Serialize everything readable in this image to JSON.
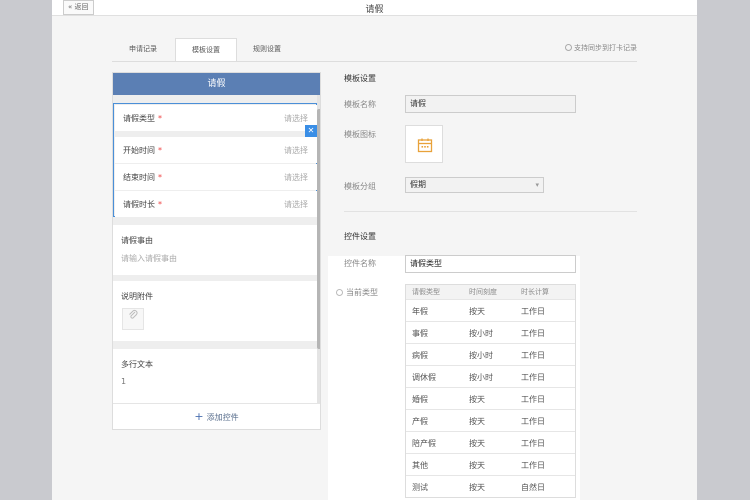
{
  "window": {
    "title": "请假",
    "back_label": "« 返回"
  },
  "tabs": [
    {
      "label": "申请记录",
      "active": false
    },
    {
      "label": "模板设置",
      "active": true
    },
    {
      "label": "规则设置",
      "active": false
    }
  ],
  "sync_label": "支持同步到打卡记录",
  "form_preview": {
    "header": "请假",
    "selected_fields": [
      {
        "label": "请假类型",
        "required_mark": "*",
        "placeholder": "请选择"
      },
      {
        "label": "开始时间",
        "required_mark": "*",
        "placeholder": "请选择"
      },
      {
        "label": "结束时间",
        "required_mark": "*",
        "placeholder": "请选择"
      },
      {
        "label": "请假时长",
        "required_mark": "*",
        "placeholder": "请选择"
      }
    ],
    "reason": {
      "label": "请假事由",
      "placeholder": "请输入请假事由"
    },
    "attachment": {
      "label": "说明附件"
    },
    "multiline": {
      "label": "多行文本",
      "value": "1"
    },
    "add_control_label": "添加控件"
  },
  "template_settings": {
    "section_title": "模板设置",
    "name_label": "模板名称",
    "name_value": "请假",
    "icon_label": "模板图标",
    "group_label": "模板分组",
    "group_value": "假期"
  },
  "control_settings": {
    "section_title": "控件设置",
    "control_name_label": "控件名称",
    "control_name_value": "请假类型",
    "current_type_label": "当前类型",
    "table_headers": [
      "请假类型",
      "时间刻度",
      "时长计算"
    ],
    "rows": [
      [
        "年假",
        "按天",
        "工作日"
      ],
      [
        "事假",
        "按小时",
        "工作日"
      ],
      [
        "病假",
        "按小时",
        "工作日"
      ],
      [
        "调休假",
        "按小时",
        "工作日"
      ],
      [
        "婚假",
        "按天",
        "工作日"
      ],
      [
        "产假",
        "按天",
        "工作日"
      ],
      [
        "陪产假",
        "按天",
        "工作日"
      ],
      [
        "其他",
        "按天",
        "工作日"
      ],
      [
        "测试",
        "按天",
        "自然日"
      ]
    ]
  },
  "colors": {
    "header_blue": "#5b7fb4",
    "selection_blue": "#4a8fd8",
    "required_red": "#e44444"
  },
  "icons": [
    "calendar-icon",
    "paperclip-icon",
    "close-icon",
    "plus-icon",
    "dropdown-arrow-icon"
  ]
}
